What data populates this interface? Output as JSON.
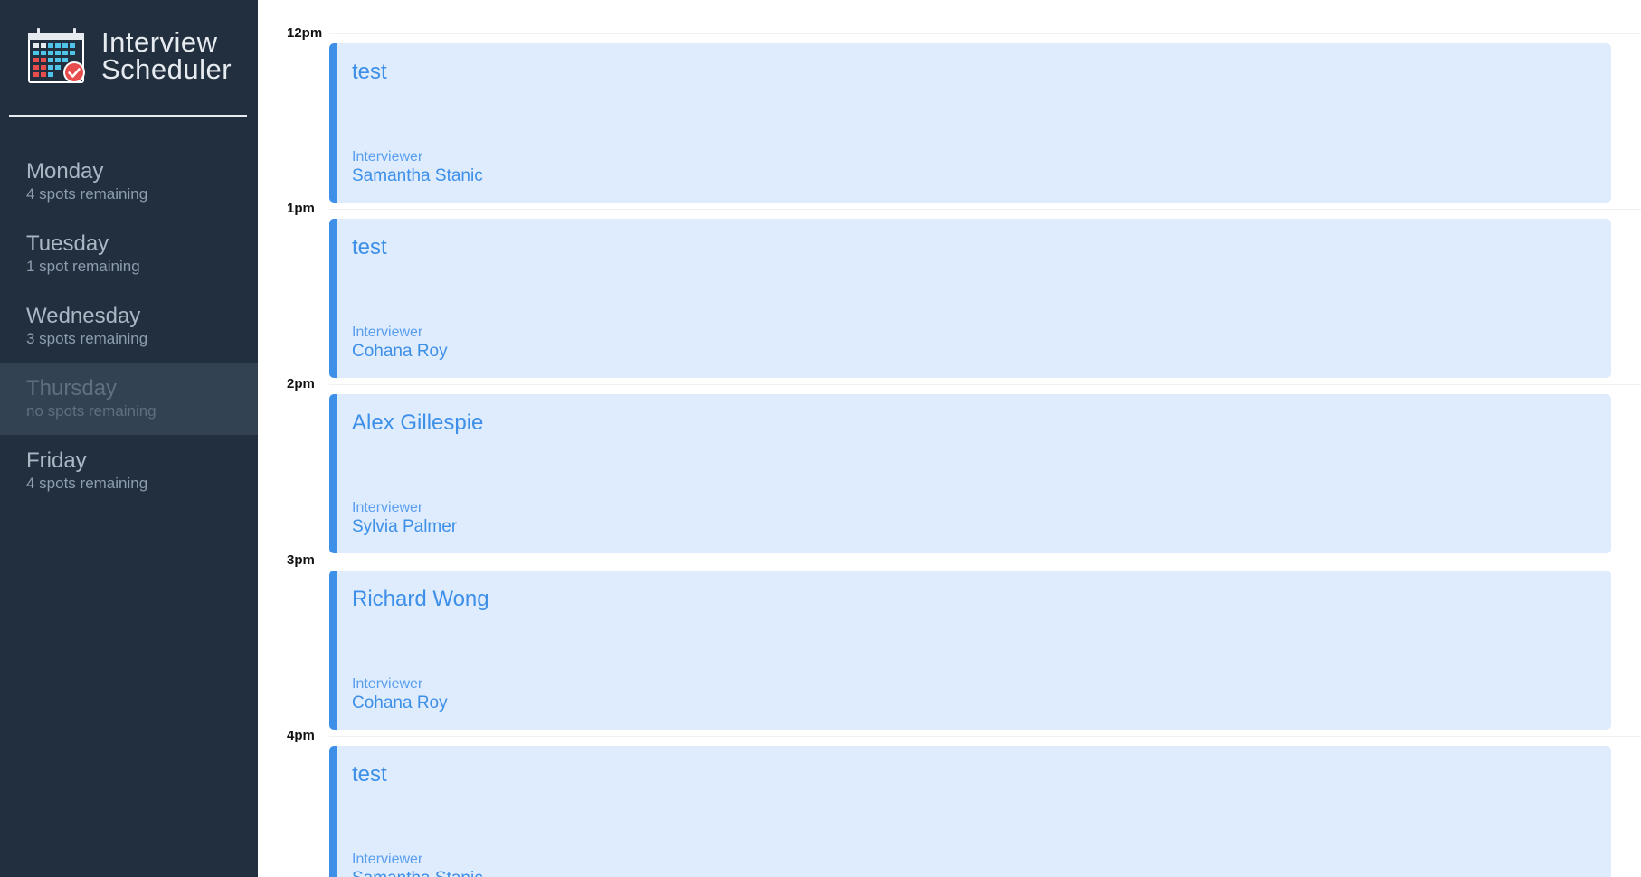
{
  "app": {
    "title_line1": "Interview",
    "title_line2": "Scheduler"
  },
  "days": [
    {
      "name": "Monday",
      "spots": "4 spots remaining"
    },
    {
      "name": "Tuesday",
      "spots": "1 spot remaining"
    },
    {
      "name": "Wednesday",
      "spots": "3 spots remaining"
    },
    {
      "name": "Thursday",
      "spots": "no spots remaining",
      "selected": true
    },
    {
      "name": "Friday",
      "spots": "4 spots remaining"
    }
  ],
  "appointments": [
    {
      "time": "12pm",
      "student": "test",
      "interviewer_label": "Interviewer",
      "interviewer": "Samantha Stanic"
    },
    {
      "time": "1pm",
      "student": "test",
      "interviewer_label": "Interviewer",
      "interviewer": "Cohana Roy"
    },
    {
      "time": "2pm",
      "student": "Alex Gillespie",
      "interviewer_label": "Interviewer",
      "interviewer": "Sylvia Palmer"
    },
    {
      "time": "3pm",
      "student": "Richard Wong",
      "interviewer_label": "Interviewer",
      "interviewer": "Cohana Roy"
    },
    {
      "time": "4pm",
      "student": "test",
      "interviewer_label": "Interviewer",
      "interviewer": "Samantha Stanic"
    }
  ],
  "colors": {
    "sidebar_bg": "#222f3e",
    "selected_day_bg": "#334252",
    "appointment_bg": "#deecfd",
    "accent": "#3d8fe8"
  },
  "icons": {
    "logo": "calendar-check-icon"
  }
}
